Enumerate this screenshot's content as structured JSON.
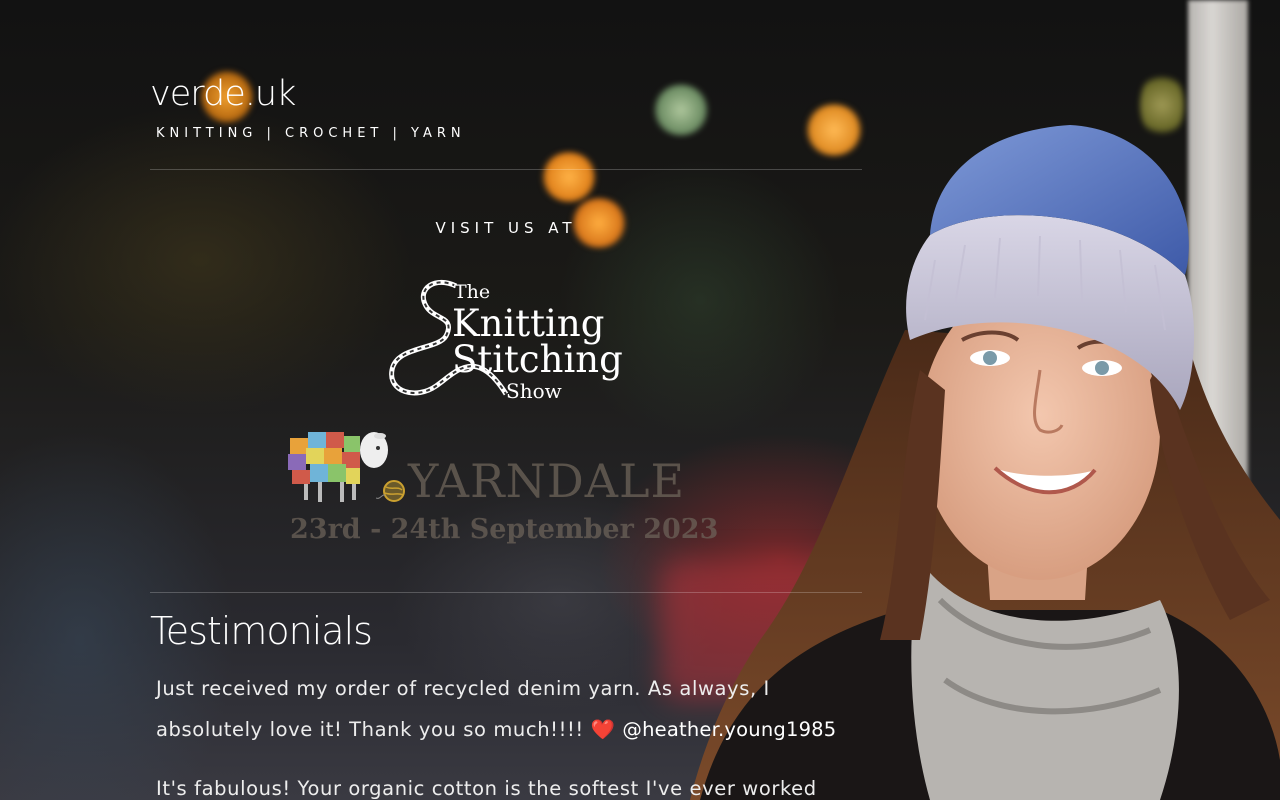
{
  "brand": {
    "logo": "verde.uk",
    "tagline": "KNITTING | CROCHET | YARN"
  },
  "events": {
    "heading": "VISIT US AT",
    "kss_logo": {
      "the": "The",
      "line1": "Knitting",
      "line2": "Stitching",
      "line3": "Show",
      "ampersand": "&"
    },
    "yarndale": {
      "title": "YARNDALE",
      "dates": "23rd - 24th September 2023"
    }
  },
  "testimonials": {
    "heading": "Testimonials",
    "items": [
      {
        "text": "Just received my order of recycled denim yarn. As always, I absolutely love it! Thank you so much!!!!",
        "emoji": "❤️",
        "handle": "@heather.young1985"
      },
      {
        "text": "It's fabulous! Your organic cotton is the softest I've ever worked",
        "emoji": "",
        "handle": ""
      }
    ]
  },
  "colors": {
    "text": "#ffffff",
    "heart": "#e0242b",
    "yarndale": "#6e645a"
  },
  "icons": [
    "sheep-icon",
    "yarn-ball-icon"
  ]
}
